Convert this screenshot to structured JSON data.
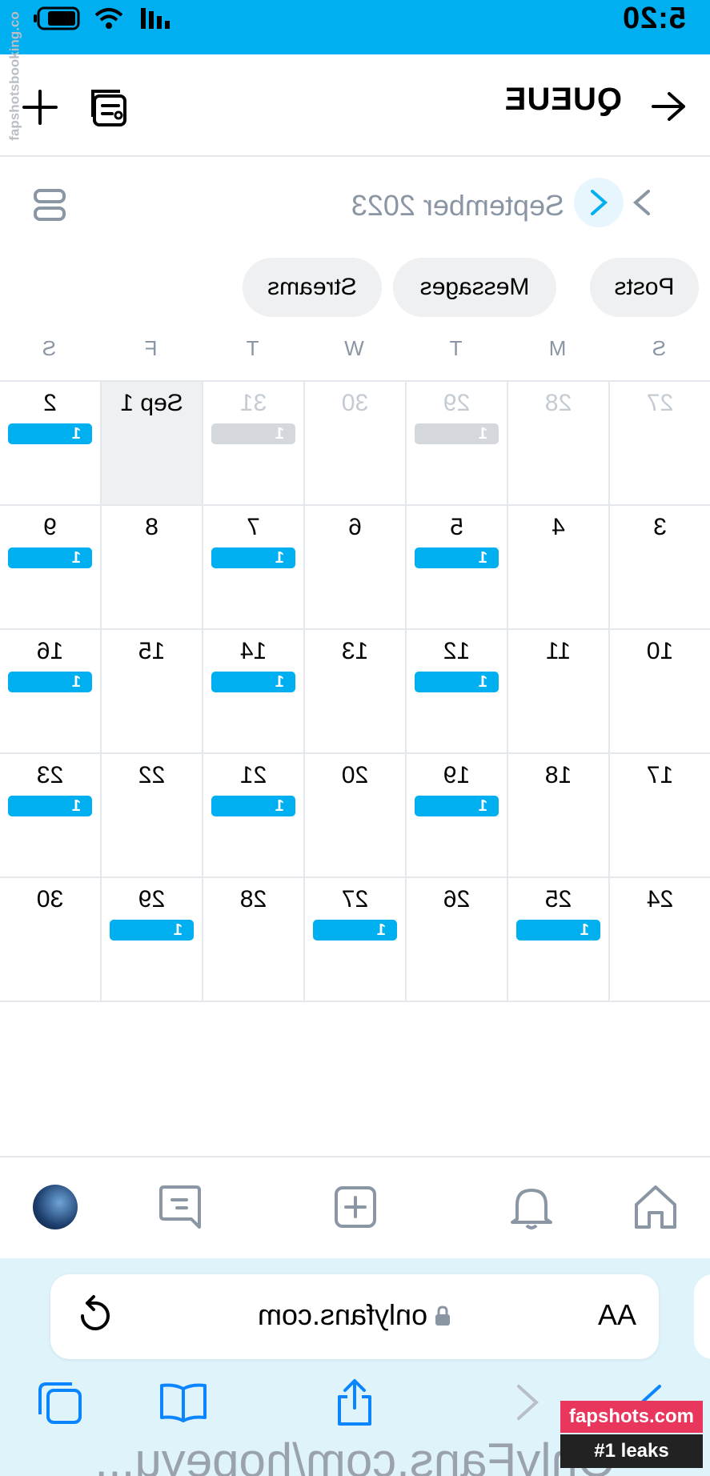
{
  "status_bar": {
    "time": "5:20",
    "watermark": "fapshotsbooking.co"
  },
  "header": {
    "title": "QUEUE"
  },
  "calendar_nav": {
    "month": "September 2023"
  },
  "filters": [
    {
      "label": "Posts"
    },
    {
      "label": "Messages"
    },
    {
      "label": "Streams"
    }
  ],
  "weekdays": [
    "S",
    "M",
    "T",
    "W",
    "T",
    "F",
    "S"
  ],
  "weeks": [
    [
      {
        "day": "27",
        "muted": true,
        "count": ""
      },
      {
        "day": "28",
        "muted": true,
        "count": ""
      },
      {
        "day": "29",
        "muted": true,
        "count": "1"
      },
      {
        "day": "30",
        "muted": true,
        "count": ""
      },
      {
        "day": "31",
        "muted": true,
        "count": "1"
      },
      {
        "day": "Sep 1",
        "muted": false,
        "today": true,
        "count": ""
      },
      {
        "day": "2",
        "muted": false,
        "count": "1"
      }
    ],
    [
      {
        "day": "3",
        "count": ""
      },
      {
        "day": "4",
        "count": ""
      },
      {
        "day": "5",
        "count": "1"
      },
      {
        "day": "6",
        "count": ""
      },
      {
        "day": "7",
        "count": "1"
      },
      {
        "day": "8",
        "count": ""
      },
      {
        "day": "9",
        "count": "1"
      }
    ],
    [
      {
        "day": "10",
        "count": ""
      },
      {
        "day": "11",
        "count": ""
      },
      {
        "day": "12",
        "count": "1"
      },
      {
        "day": "13",
        "count": ""
      },
      {
        "day": "14",
        "count": "1"
      },
      {
        "day": "15",
        "count": ""
      },
      {
        "day": "16",
        "count": "1"
      }
    ],
    [
      {
        "day": "17",
        "count": ""
      },
      {
        "day": "18",
        "count": ""
      },
      {
        "day": "19",
        "count": "1"
      },
      {
        "day": "20",
        "count": ""
      },
      {
        "day": "21",
        "count": "1"
      },
      {
        "day": "22",
        "count": ""
      },
      {
        "day": "23",
        "count": "1"
      }
    ],
    [
      {
        "day": "24",
        "count": ""
      },
      {
        "day": "25",
        "count": "1"
      },
      {
        "day": "26",
        "count": ""
      },
      {
        "day": "27",
        "count": "1"
      },
      {
        "day": "28",
        "count": ""
      },
      {
        "day": "29",
        "count": "1"
      },
      {
        "day": "30",
        "count": ""
      }
    ]
  ],
  "app_nav": {
    "icons": [
      "home-icon",
      "bell-icon",
      "add-post-icon",
      "messages-icon",
      "avatar"
    ]
  },
  "browser": {
    "aa_label": "AA",
    "url": "onlyfans.com",
    "bottom_text": "OnlyFans.com/hopeyu..."
  },
  "watermark_badge": {
    "line1": "fapshots.com",
    "line2": "#1 leaks"
  },
  "colors": {
    "accent": "#00aff0",
    "muted_badge": "#d4d8dc",
    "text_muted": "#8a96a3"
  }
}
